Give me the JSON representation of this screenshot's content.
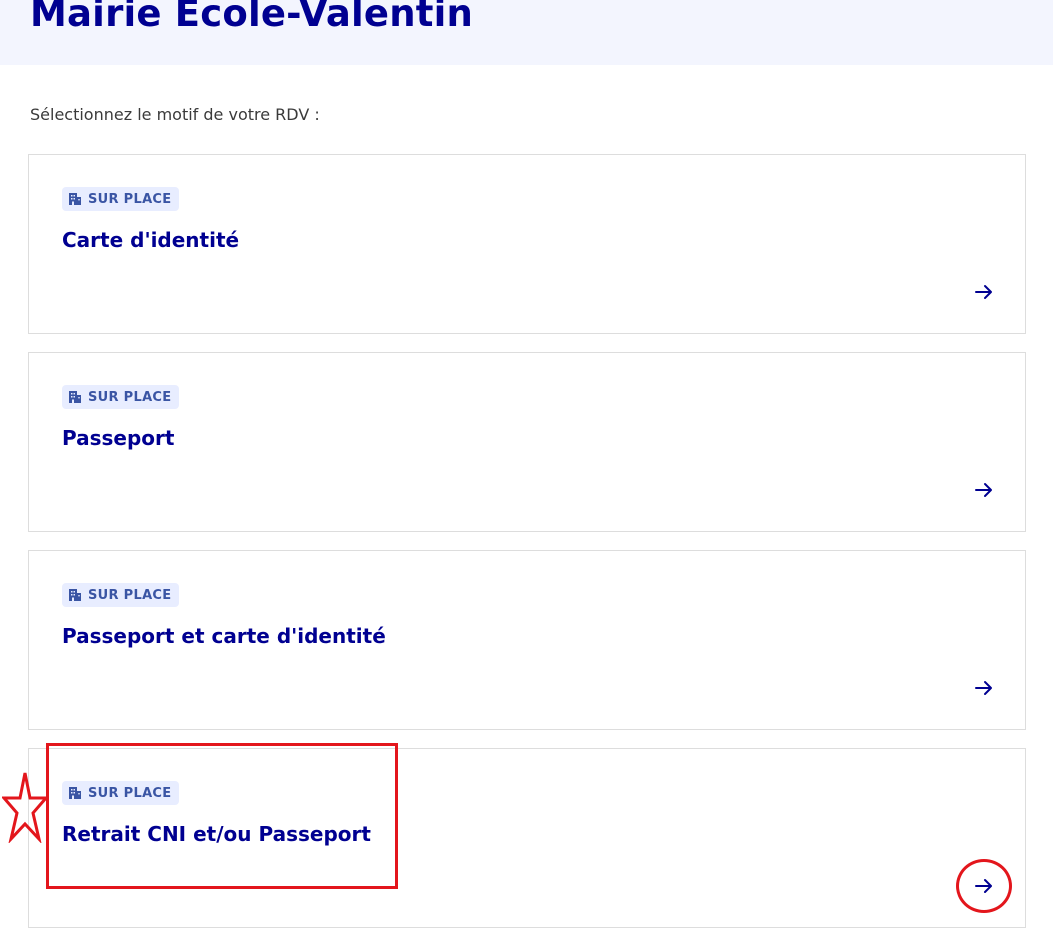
{
  "page": {
    "title": "Mairie Ecole-Valentin",
    "prompt": "Sélectionnez le motif de votre RDV :"
  },
  "cards": [
    {
      "badge": "SUR PLACE",
      "badge_icon": "building-icon",
      "title": "Carte d'identité",
      "action_icon": "arrow-right-icon"
    },
    {
      "badge": "SUR PLACE",
      "badge_icon": "building-icon",
      "title": "Passeport",
      "action_icon": "arrow-right-icon"
    },
    {
      "badge": "SUR PLACE",
      "badge_icon": "building-icon",
      "title": "Passeport et carte d'identité",
      "action_icon": "arrow-right-icon"
    },
    {
      "badge": "SUR PLACE",
      "badge_icon": "building-icon",
      "title": "Retrait CNI et/ou Passeport",
      "action_icon": "arrow-right-icon"
    }
  ],
  "annotations": {
    "color": "#e3161c",
    "shapes": [
      "rectangle",
      "circle",
      "star"
    ]
  },
  "colors": {
    "accent": "#000091",
    "header_bg": "#f3f5fe",
    "badge_bg": "#e8edff",
    "badge_text": "#3a55a4",
    "card_border": "#dddddd"
  }
}
